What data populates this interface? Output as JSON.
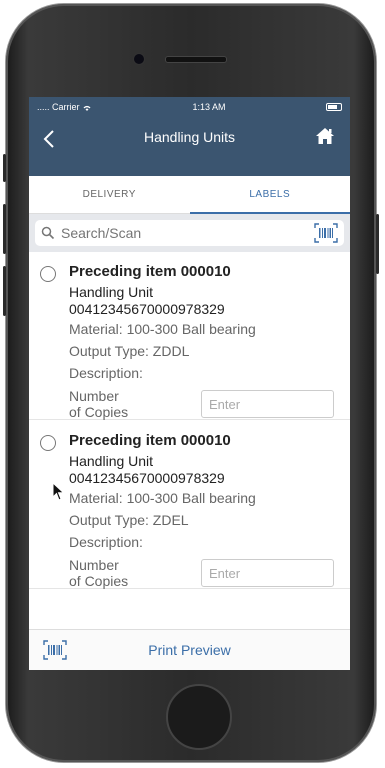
{
  "status_bar": {
    "carrier": "..... Carrier",
    "time": "1:13 AM"
  },
  "navbar": {
    "title": "Handling Units"
  },
  "tabs": [
    {
      "label": "DELIVERY",
      "active": false
    },
    {
      "label": "LABELS",
      "active": true
    }
  ],
  "search": {
    "placeholder": "Search/Scan"
  },
  "items": [
    {
      "heading": "Preceding item 000010",
      "hu_label": "Handling Unit",
      "hu_number": "00412345670000978329",
      "material": "Material: 100-300 Ball bearing",
      "output_type": "Output Type: ZDDL",
      "description": "Description:",
      "copies_label_1": "Number",
      "copies_label_2": "of Copies",
      "copies_placeholder": "Enter"
    },
    {
      "heading": "Preceding item 000010",
      "hu_label": "Handling Unit",
      "hu_number": "00412345670000978329",
      "material": "Material: 100-300 Ball bearing",
      "output_type": "Output Type: ZDEL",
      "description": "Description:",
      "copies_label_1": "Number",
      "copies_label_2": "of Copies",
      "copies_placeholder": "Enter"
    }
  ],
  "footer": {
    "print_preview": "Print Preview"
  },
  "colors": {
    "header": "#3b5570",
    "accent": "#3b6ea8"
  },
  "icons": [
    "wifi-icon",
    "battery-icon",
    "back-chevron-icon",
    "home-icon",
    "search-icon",
    "barcode-scan-icon",
    "cursor-icon"
  ]
}
